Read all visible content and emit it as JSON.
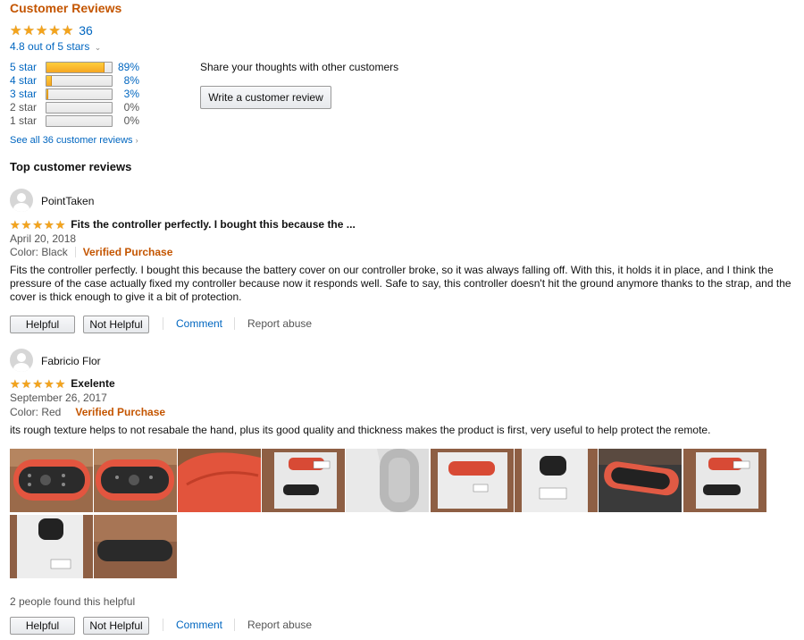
{
  "header": {
    "title": "Customer Reviews",
    "review_count": "36",
    "rating_text": "4.8 out of 5 stars",
    "rating_value": 4.8
  },
  "histogram": [
    {
      "label": "5 star",
      "pct": "89%",
      "fraction": 0.89,
      "linked": true
    },
    {
      "label": "4 star",
      "pct": "8%",
      "fraction": 0.08,
      "linked": true
    },
    {
      "label": "3 star",
      "pct": "3%",
      "fraction": 0.03,
      "linked": true
    },
    {
      "label": "2 star",
      "pct": "0%",
      "fraction": 0.0,
      "linked": false
    },
    {
      "label": "1 star",
      "pct": "0%",
      "fraction": 0.0,
      "linked": false
    }
  ],
  "see_all": "See all 36 customer reviews",
  "share": {
    "prompt": "Share your thoughts with other customers",
    "button": "Write a customer review"
  },
  "top_reviews_heading": "Top customer reviews",
  "reviews": [
    {
      "author": "PointTaken",
      "stars": 5,
      "title": "Fits the controller perfectly. I bought this because the ...",
      "date": "April 20, 2018",
      "color_label": "Color: Black",
      "verified": "Verified Purchase",
      "body": "Fits the controller perfectly. I bought this because the battery cover on our controller broke, so it was always falling off. With this, it holds it in place, and I think the pressure of the case actually fixed my controller because now it responds well. Safe to say, this controller doesn't hit the ground anymore thanks to the strap, and the cover is thick enough to give it a bit of protection.",
      "helpful_btn": "Helpful",
      "not_helpful_btn": "Not Helpful",
      "comment": "Comment",
      "report": "Report abuse"
    },
    {
      "author": "Fabricio Flor",
      "stars": 5,
      "title": "Exelente",
      "date": "September 26, 2017",
      "color_label": "Color: Red",
      "verified": "Verified Purchase",
      "body": "its rough texture helps to not resabale the hand, plus its good quality and thickness makes the product is first, very useful to help protect the remote.",
      "helpful_count": "2 people found this helpful",
      "helpful_btn": "Helpful",
      "not_helpful_btn": "Not Helpful",
      "comment": "Comment",
      "report": "Report abuse"
    }
  ],
  "colors": {
    "accent_orange": "#c45500",
    "link_blue": "#0066c0",
    "star": "#f4a41c"
  },
  "icons": {
    "star": "star-icon",
    "avatar": "default-avatar-icon",
    "chevron": "chevron-down-icon",
    "caret": "chevron-right-icon"
  }
}
